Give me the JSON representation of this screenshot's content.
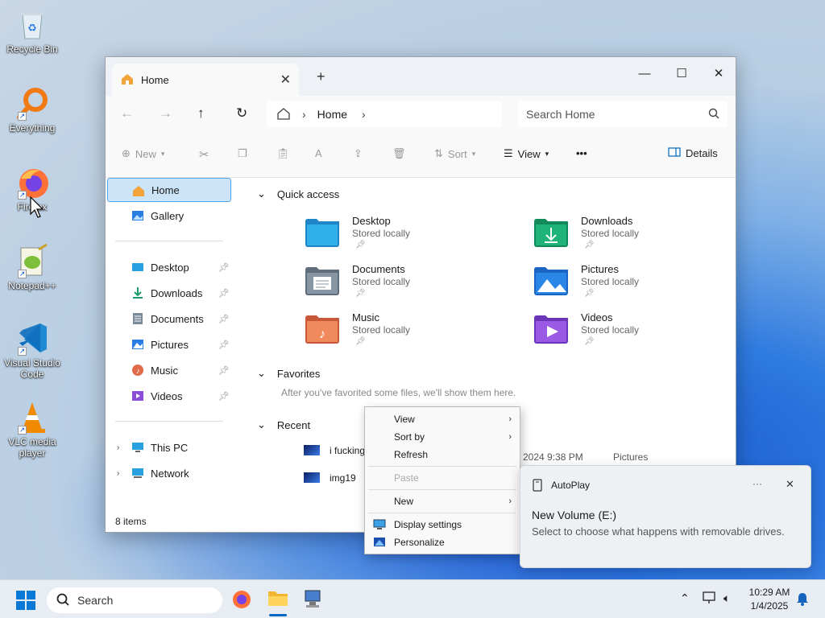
{
  "desktop": {
    "icons": [
      {
        "label": "Recycle Bin"
      },
      {
        "label": "Everything"
      },
      {
        "label": "Firefox"
      },
      {
        "label": "Notepad++"
      },
      {
        "label": "Visual Studio Code"
      },
      {
        "label": "VLC media player"
      }
    ]
  },
  "explorer": {
    "tab_title": "Home",
    "tab_close": "✕",
    "new_tab": "+",
    "controls": {
      "minimize": "—",
      "maximize": "☐",
      "close": "✕"
    },
    "breadcrumb": {
      "root": "Home"
    },
    "search_placeholder": "Search Home",
    "toolbar": {
      "new": "New",
      "sort": "Sort",
      "view": "View",
      "more": "•••",
      "details": "Details"
    },
    "sidebar": {
      "home": "Home",
      "gallery": "Gallery",
      "pinned": [
        {
          "label": "Desktop"
        },
        {
          "label": "Downloads"
        },
        {
          "label": "Documents"
        },
        {
          "label": "Pictures"
        },
        {
          "label": "Music"
        },
        {
          "label": "Videos"
        }
      ],
      "this_pc": "This PC",
      "network": "Network"
    },
    "quick_access": {
      "title": "Quick access",
      "folders": [
        {
          "name": "Desktop",
          "status": "Stored locally"
        },
        {
          "name": "Downloads",
          "status": "Stored locally"
        },
        {
          "name": "Documents",
          "status": "Stored locally"
        },
        {
          "name": "Pictures",
          "status": "Stored locally"
        },
        {
          "name": "Music",
          "status": "Stored locally"
        },
        {
          "name": "Videos",
          "status": "Stored locally"
        }
      ]
    },
    "favorites": {
      "title": "Favorites",
      "empty_text": "After you've favorited some files, we'll show them here."
    },
    "recent": {
      "title": "Recent",
      "items": [
        {
          "name": "i fucking",
          "date": "2024 9:38 PM",
          "location": "Pictures"
        },
        {
          "name": "img19"
        }
      ]
    },
    "status_bar": "8 items"
  },
  "context_menu": {
    "items": [
      {
        "label": "View"
      },
      {
        "label": "Sort by"
      },
      {
        "label": "Refresh"
      },
      {
        "label": "Paste"
      },
      {
        "label": "New"
      },
      {
        "label": "Display settings"
      },
      {
        "label": "Personalize"
      }
    ]
  },
  "toast": {
    "app": "AutoPlay",
    "more": "···",
    "close": "✕",
    "title": "New Volume (E:)",
    "body": "Select to choose what happens with removable drives."
  },
  "taskbar": {
    "search_placeholder": "Search",
    "time": "10:29 AM",
    "date": "1/4/2025"
  },
  "colors": {
    "accent": "#0067c0",
    "selection": "#cce4f7"
  }
}
